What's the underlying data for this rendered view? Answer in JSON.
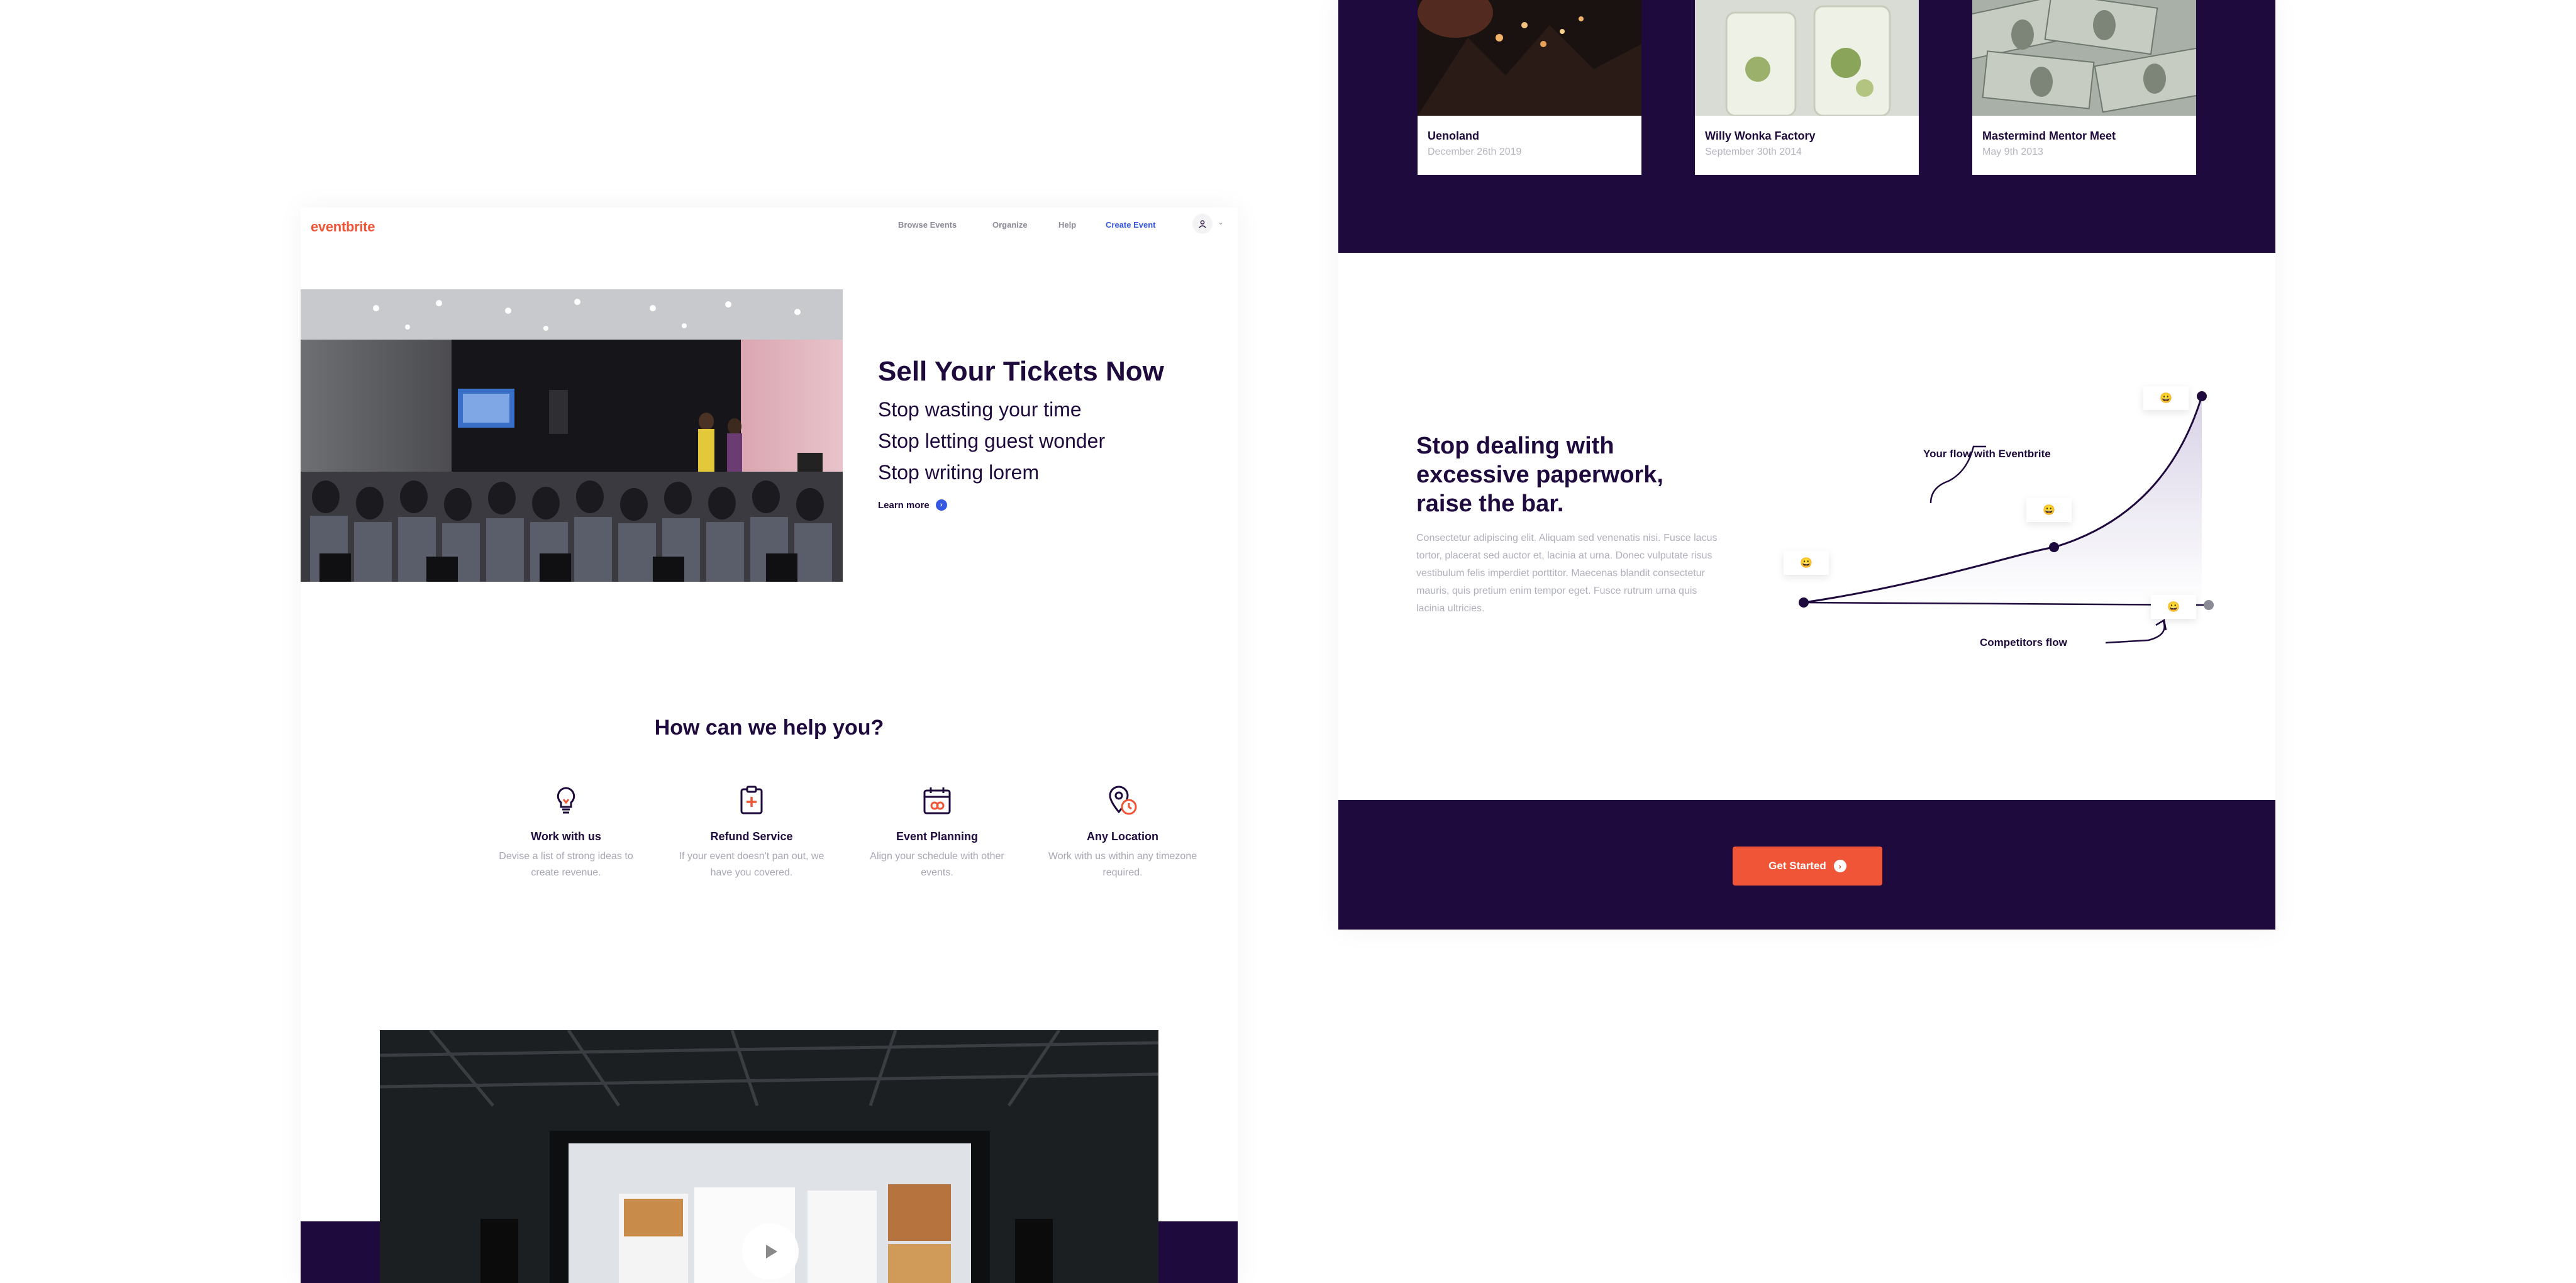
{
  "nav": {
    "logo": "eventbrite",
    "links": [
      "Browse Events",
      "Organize",
      "Help"
    ],
    "create": "Create Event"
  },
  "hero": {
    "title": "Sell Your Tickets Now",
    "lines": [
      "Stop wasting your time",
      "Stop letting guest wonder",
      "Stop writing lorem"
    ],
    "learn_more": "Learn more"
  },
  "help": {
    "title": "How can we help you?",
    "features": [
      {
        "title": "Work with us",
        "desc": "Devise a list of strong ideas to create revenue.",
        "icon": "lightbulb-icon"
      },
      {
        "title": "Refund Service",
        "desc": "If your event doesn't pan out, we have you covered.",
        "icon": "clipboard-plus-icon"
      },
      {
        "title": "Event Planning",
        "desc": "Align your schedule with other events.",
        "icon": "calendar-icon"
      },
      {
        "title": "Any Location",
        "desc": "Work with us within any timezone required.",
        "icon": "location-clock-icon"
      }
    ]
  },
  "events": [
    {
      "name": "Uenoland",
      "date": "December 26th 2019"
    },
    {
      "name": "Willy Wonka Factory",
      "date": "September 30th 2014"
    },
    {
      "name": "Mastermind Mentor Meet",
      "date": "May 9th 2013"
    }
  ],
  "paperwork": {
    "title": "Stop dealing with excessive paperwork, raise the bar.",
    "body": "Consectetur adipiscing elit. Aliquam sed venenatis nisi. Fusce lacus tortor, placerat sed auctor et, lacinia at urna. Donec vulputate risus vestibulum felis imperdiet porttitor. Maecenas blandit consectetur mauris, quis pretium enim tempor eget. Fusce rutrum urna quis lacinia ultricies."
  },
  "graph": {
    "flow_label": "Your flow with Eventbrite",
    "competitors_label": "Competitors flow",
    "emoji": "😀"
  },
  "cta": {
    "label": "Get Started"
  },
  "colors": {
    "brand": "#f05537",
    "dark": "#1e0a3c",
    "link": "#3659e3"
  }
}
